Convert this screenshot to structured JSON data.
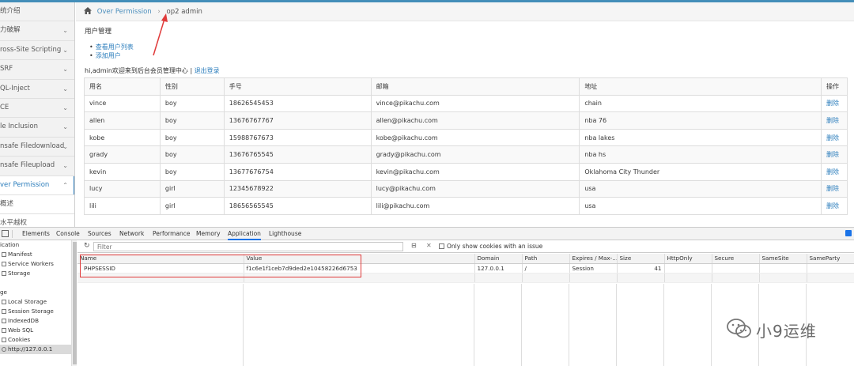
{
  "sidebar": {
    "items": [
      {
        "label": "统介绍",
        "chev": ""
      },
      {
        "label": "力破解",
        "chev": "⌄"
      },
      {
        "label": "ross-Site Scripting",
        "chev": "⌄"
      },
      {
        "label": "SRF",
        "chev": "⌄"
      },
      {
        "label": "QL-Inject",
        "chev": "⌄"
      },
      {
        "label": "CE",
        "chev": "⌄"
      },
      {
        "label": "le Inclusion",
        "chev": "⌄"
      },
      {
        "label": "nsafe Filedownload",
        "chev": "⌄"
      },
      {
        "label": "nsafe Fileupload",
        "chev": "⌄"
      },
      {
        "label": "ver Permission",
        "chev": "⌃"
      },
      {
        "label": "概述",
        "chev": ""
      },
      {
        "label": "水平越权",
        "chev": ""
      }
    ]
  },
  "breadcrumb": {
    "parent": "Over Permission",
    "separator": "›",
    "current": "op2 admin"
  },
  "content": {
    "section_title": "用户管理",
    "links": [
      "查看用户列表",
      "添加用户"
    ],
    "welcome_text": "hi,admin欢迎来到后台会员管理中心 |",
    "logout": "退出登录"
  },
  "user_table": {
    "headers": [
      "用名",
      "性别",
      "手号",
      "邮箱",
      "地址",
      "操作"
    ],
    "rows": [
      [
        "vince",
        "boy",
        "18626545453",
        "vince@pikachu.com",
        "chain",
        "删除"
      ],
      [
        "allen",
        "boy",
        "13676767767",
        "allen@pikachu.com",
        "nba 76",
        "删除"
      ],
      [
        "kobe",
        "boy",
        "15988767673",
        "kobe@pikachu.com",
        "nba lakes",
        "删除"
      ],
      [
        "grady",
        "boy",
        "13676765545",
        "grady@pikachu.com",
        "nba hs",
        "删除"
      ],
      [
        "kevin",
        "boy",
        "13677676754",
        "kevin@pikachu.com",
        "Oklahoma City Thunder",
        "删除"
      ],
      [
        "lucy",
        "girl",
        "12345678922",
        "lucy@pikachu.com",
        "usa",
        "删除"
      ],
      [
        "lili",
        "girl",
        "18656565545",
        "lili@pikachu.com",
        "usa",
        "删除"
      ]
    ]
  },
  "devtools": {
    "tabs": [
      "Elements",
      "Console",
      "Sources",
      "Network",
      "Performance",
      "Memory",
      "Application",
      "Lighthouse"
    ],
    "active_tab": "Application",
    "side_items": [
      {
        "label": "ication",
        "icon": false
      },
      {
        "label": "Manifest",
        "icon": true
      },
      {
        "label": "Service Workers",
        "icon": true
      },
      {
        "label": "Storage",
        "icon": true
      },
      {
        "label": "",
        "icon": false
      },
      {
        "label": "ge",
        "icon": false
      },
      {
        "label": "Local Storage",
        "icon": true
      },
      {
        "label": "Session Storage",
        "icon": true
      },
      {
        "label": "IndexedDB",
        "icon": true
      },
      {
        "label": "Web SQL",
        "icon": true
      },
      {
        "label": "Cookies",
        "icon": true
      },
      {
        "label": "http://127.0.0.1",
        "icon": true
      }
    ],
    "filter_placeholder": "Filter",
    "only_issue_label": "Only show cookies with an issue",
    "cookie_headers": [
      "Name",
      "Value",
      "Domain",
      "Path",
      "Expires / Max-...",
      "Size",
      "HttpOnly",
      "Secure",
      "SameSite",
      "SameParty"
    ],
    "cookie_rows": [
      [
        "PHPSESSID",
        "f1c6e1f1ceb7d9ded2e10458226d6753",
        "127.0.0.1",
        "/",
        "Session",
        "41",
        "",
        "",
        "",
        ""
      ]
    ]
  },
  "watermark": {
    "text": "小9运维"
  },
  "colors": {
    "accent": "#438eb9",
    "link": "#2b7dbc",
    "highlight": "#e03a3a"
  }
}
